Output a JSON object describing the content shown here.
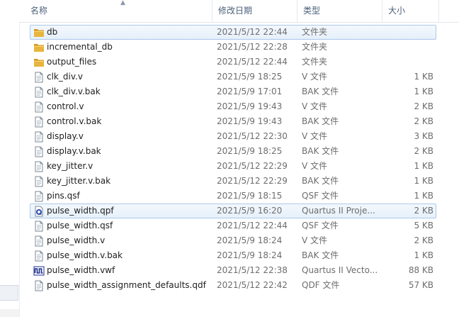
{
  "columns": {
    "name": "名称",
    "date": "修改日期",
    "type": "类型",
    "size": "大小"
  },
  "colors": {
    "folder": "#e7b53d",
    "selection_border": "#aac8ea",
    "header_text": "#4c607a"
  },
  "files": [
    {
      "name": "db",
      "date": "2021/5/12 22:44",
      "type": "文件夹",
      "size": "",
      "icon": "folder-icon",
      "selected": true
    },
    {
      "name": "incremental_db",
      "date": "2021/5/12 22:28",
      "type": "文件夹",
      "size": "",
      "icon": "folder-icon"
    },
    {
      "name": "output_files",
      "date": "2021/5/12 22:44",
      "type": "文件夹",
      "size": "",
      "icon": "folder-icon"
    },
    {
      "name": "clk_div.v",
      "date": "2021/5/9 18:25",
      "type": "V 文件",
      "size": "1 KB",
      "icon": "file-icon"
    },
    {
      "name": "clk_div.v.bak",
      "date": "2021/5/9 17:01",
      "type": "BAK 文件",
      "size": "1 KB",
      "icon": "file-icon"
    },
    {
      "name": "control.v",
      "date": "2021/5/9 19:43",
      "type": "V 文件",
      "size": "2 KB",
      "icon": "file-icon"
    },
    {
      "name": "control.v.bak",
      "date": "2021/5/9 19:43",
      "type": "BAK 文件",
      "size": "2 KB",
      "icon": "file-icon"
    },
    {
      "name": "display.v",
      "date": "2021/5/12 22:30",
      "type": "V 文件",
      "size": "3 KB",
      "icon": "file-icon"
    },
    {
      "name": "display.v.bak",
      "date": "2021/5/9 18:25",
      "type": "BAK 文件",
      "size": "2 KB",
      "icon": "file-icon"
    },
    {
      "name": "key_jitter.v",
      "date": "2021/5/12 22:29",
      "type": "V 文件",
      "size": "1 KB",
      "icon": "file-icon"
    },
    {
      "name": "key_jitter.v.bak",
      "date": "2021/5/12 22:29",
      "type": "BAK 文件",
      "size": "1 KB",
      "icon": "file-icon"
    },
    {
      "name": "pins.qsf",
      "date": "2021/5/9 18:15",
      "type": "QSF 文件",
      "size": "1 KB",
      "icon": "file-icon"
    },
    {
      "name": "pulse_width.qpf",
      "date": "2021/5/9 16:20",
      "type": "Quartus II Proje...",
      "size": "2 KB",
      "icon": "quartus-project-icon",
      "selected": true
    },
    {
      "name": "pulse_width.qsf",
      "date": "2021/5/12 22:44",
      "type": "QSF 文件",
      "size": "5 KB",
      "icon": "file-icon"
    },
    {
      "name": "pulse_width.v",
      "date": "2021/5/9 18:24",
      "type": "V 文件",
      "size": "2 KB",
      "icon": "file-icon"
    },
    {
      "name": "pulse_width.v.bak",
      "date": "2021/5/9 18:24",
      "type": "BAK 文件",
      "size": "1 KB",
      "icon": "file-icon"
    },
    {
      "name": "pulse_width.vwf",
      "date": "2021/5/12 22:38",
      "type": "Quartus II Vecto...",
      "size": "88 KB",
      "icon": "waveform-icon"
    },
    {
      "name": "pulse_width_assignment_defaults.qdf",
      "date": "2021/5/12 22:42",
      "type": "QDF 文件",
      "size": "57 KB",
      "icon": "file-icon"
    }
  ]
}
